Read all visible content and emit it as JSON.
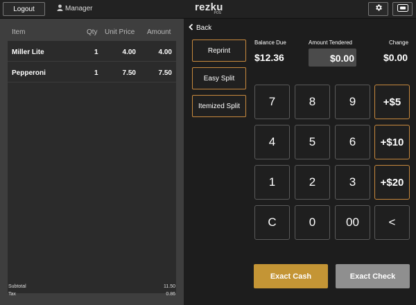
{
  "topbar": {
    "logout_label": "Logout",
    "user_label": "Manager",
    "logo_brand": "rezku",
    "logo_sub": "POS"
  },
  "order": {
    "headers": {
      "item": "Item",
      "qty": "Qty",
      "unit_price": "Unit Price",
      "amount": "Amount"
    },
    "rows": [
      {
        "item": "Miller Lite",
        "qty": "1",
        "unit_price": "4.00",
        "amount": "4.00"
      },
      {
        "item": "Pepperoni",
        "qty": "1",
        "unit_price": "7.50",
        "amount": "7.50"
      }
    ],
    "subtotal_label": "Subtotal",
    "subtotal_value": "11.50",
    "tax_label": "Tax",
    "tax_value": "0.86"
  },
  "payment": {
    "back_label": "Back",
    "side_buttons": [
      "Reprint",
      "Easy Split",
      "Itemized Split"
    ],
    "balance_due_label": "Balance Due",
    "balance_due_value": "$12.36",
    "amount_tendered_label": "Amount Tendered",
    "amount_tendered_value": "$0.00",
    "change_label": "Change",
    "change_value": "$0.00",
    "keypad": [
      [
        "7",
        "8",
        "9",
        "+$5"
      ],
      [
        "4",
        "5",
        "6",
        "+$10"
      ],
      [
        "1",
        "2",
        "3",
        "+$20"
      ],
      [
        "C",
        "0",
        "00",
        "<"
      ]
    ],
    "exact_cash_label": "Exact Cash",
    "exact_check_label": "Exact Check"
  },
  "colors": {
    "accent": "#c98a3e",
    "exact_cash_bg": "#c49535",
    "exact_check_bg": "#8f8f8f",
    "background": "#1d1d1d",
    "order_panel": "#3e3e3e"
  },
  "icons": [
    "user-icon",
    "gear-icon",
    "card-reader-icon",
    "chevron-left-icon"
  ]
}
